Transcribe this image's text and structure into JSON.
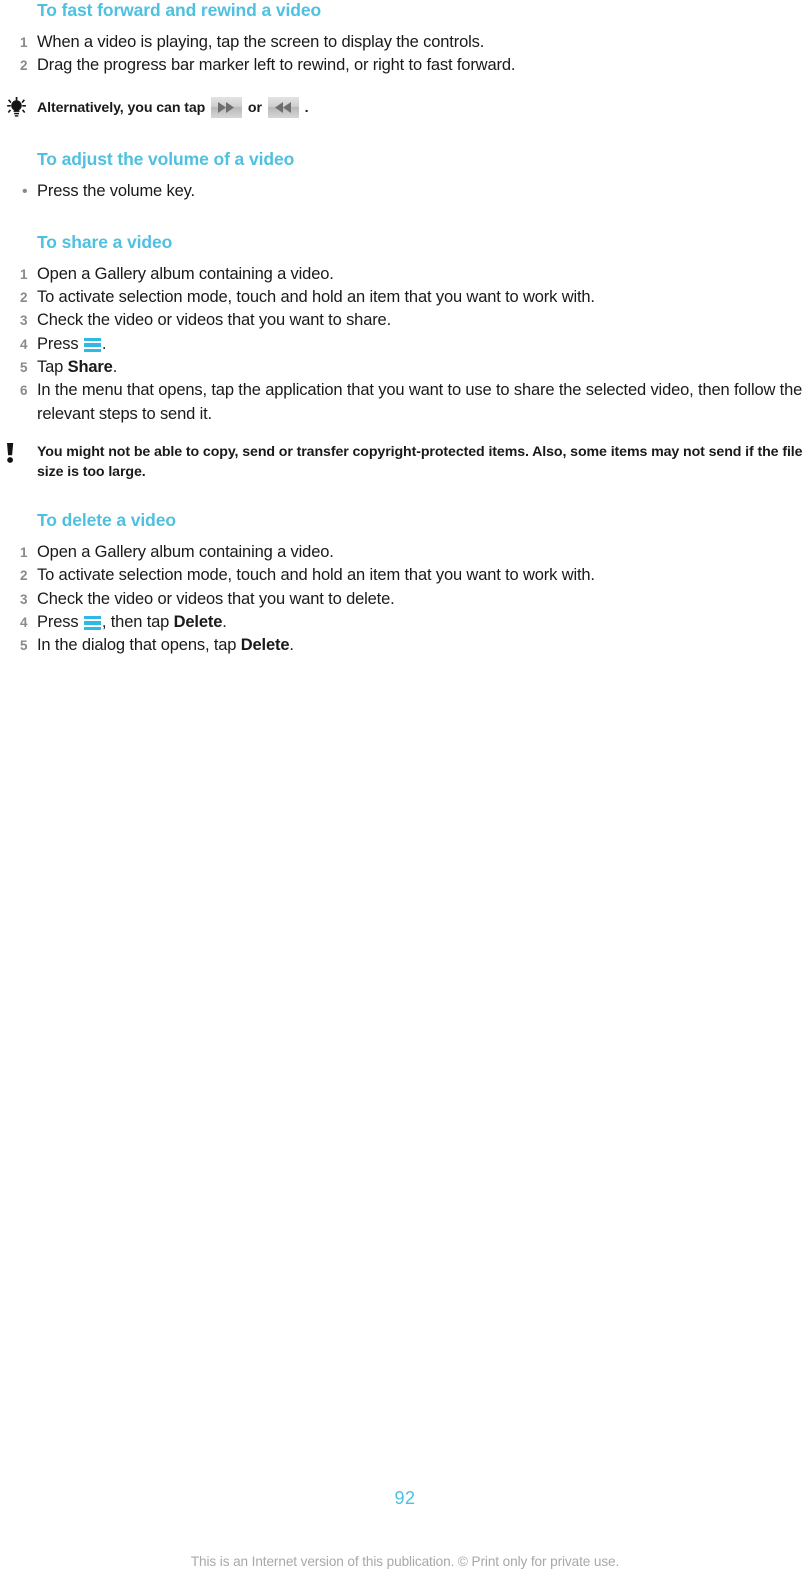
{
  "document": {
    "page_number": "92",
    "footer_note": "This is an Internet version of this publication. © Print only for private use.",
    "heading_color": "#4fc0e0",
    "icon_accent_color": "#2fb9e4",
    "step_number_color": "#8a8a8a"
  },
  "sections": [
    {
      "heading": "To fast forward and rewind a video",
      "steps": [
        {
          "num": "1",
          "text": "When a video is playing, tap the screen to display the controls."
        },
        {
          "num": "2",
          "text": "Drag the progress bar marker left to rewind, or right to fast forward."
        }
      ],
      "tip": {
        "icon": "lightbulb-icon",
        "text_before": "Alternatively, you can tap",
        "text_middle": "or",
        "text_after": ".",
        "icon_one": "fast-forward-icon",
        "icon_two": "rewind-icon"
      }
    },
    {
      "heading": "To adjust the volume of a video",
      "bullets": [
        {
          "bullet": "•",
          "text": "Press the volume key."
        }
      ]
    },
    {
      "heading": "To share a video",
      "steps": [
        {
          "num": "1",
          "text": "Open a Gallery album containing a video."
        },
        {
          "num": "2",
          "text": "To activate selection mode, touch and hold an item that you want to work with."
        },
        {
          "num": "3",
          "text": "Check the video or videos that you want to share."
        },
        {
          "num": "4",
          "text_before": "Press",
          "icon": "menu-icon",
          "text_after": "."
        },
        {
          "num": "5",
          "text_before": "Tap",
          "bold": "Share",
          "text_after": "."
        },
        {
          "num": "6",
          "text": "In the menu that opens, tap the application that you want to use to share the selected video, then follow the relevant steps to send it."
        }
      ],
      "warning": {
        "icon": "exclamation-icon",
        "text": "You might not be able to copy, send or transfer copyright-protected items. Also, some items may not send if the file size is too large."
      }
    },
    {
      "heading": "To delete a video",
      "steps": [
        {
          "num": "1",
          "text": "Open a Gallery album containing a video."
        },
        {
          "num": "2",
          "text": "To activate selection mode, touch and hold an item that you want to work with."
        },
        {
          "num": "3",
          "text": "Check the video or videos that you want to delete."
        },
        {
          "num": "4",
          "text_before": "Press",
          "icon": "menu-icon",
          "text_mid": ", then tap",
          "bold": "Delete",
          "text_after": "."
        },
        {
          "num": "5",
          "text_before": "In the dialog that opens, tap",
          "bold": "Delete",
          "text_after": "."
        }
      ]
    }
  ]
}
